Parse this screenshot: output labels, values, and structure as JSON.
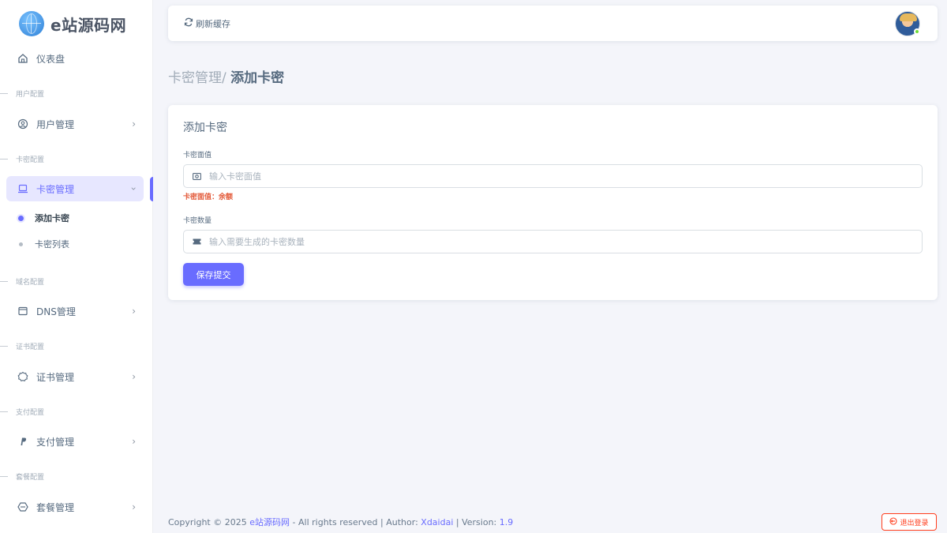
{
  "brand": {
    "name": "e站源码网"
  },
  "sidebar": {
    "dashboard": "仪表盘",
    "sections": {
      "user": "用户配置",
      "card": "卡密配置",
      "domain": "域名配置",
      "cert": "证书配置",
      "pay": "支付配置",
      "package": "套餐配置"
    },
    "items": {
      "user_mgmt": "用户管理",
      "card_mgmt": "卡密管理",
      "dns_mgmt": "DNS管理",
      "cert_mgmt": "证书管理",
      "pay_mgmt": "支付管理",
      "package_mgmt": "套餐管理"
    },
    "sub_items": {
      "add_card": "添加卡密",
      "card_list": "卡密列表"
    },
    "active_item": "卡密管理",
    "active_sub_item": "添加卡密"
  },
  "navbar": {
    "refresh_label": "刷新缓存",
    "avatar_status_color": "#71dd37"
  },
  "breadcrumb": {
    "parent": "卡密管理/",
    "current": "添加卡密"
  },
  "form": {
    "title": "添加卡密",
    "value_label": "卡密面值",
    "value_placeholder": "输入卡密面值",
    "value_error": "卡密面值：余额",
    "count_label": "卡密数量",
    "count_placeholder": "输入需要生成的卡密数量",
    "submit_label": "保存提交"
  },
  "footer": {
    "copyright": "Copyright © 2025",
    "site_name": "e站源码网",
    "rights": "- All rights reserved | Author:",
    "author": "Xdaidai",
    "version_label": "| Version:",
    "version": "1.9"
  },
  "logout_label": "退出登录",
  "colors": {
    "primary": "#696cff",
    "danger": "#ff3e1d",
    "background": "#f4f5fa"
  }
}
